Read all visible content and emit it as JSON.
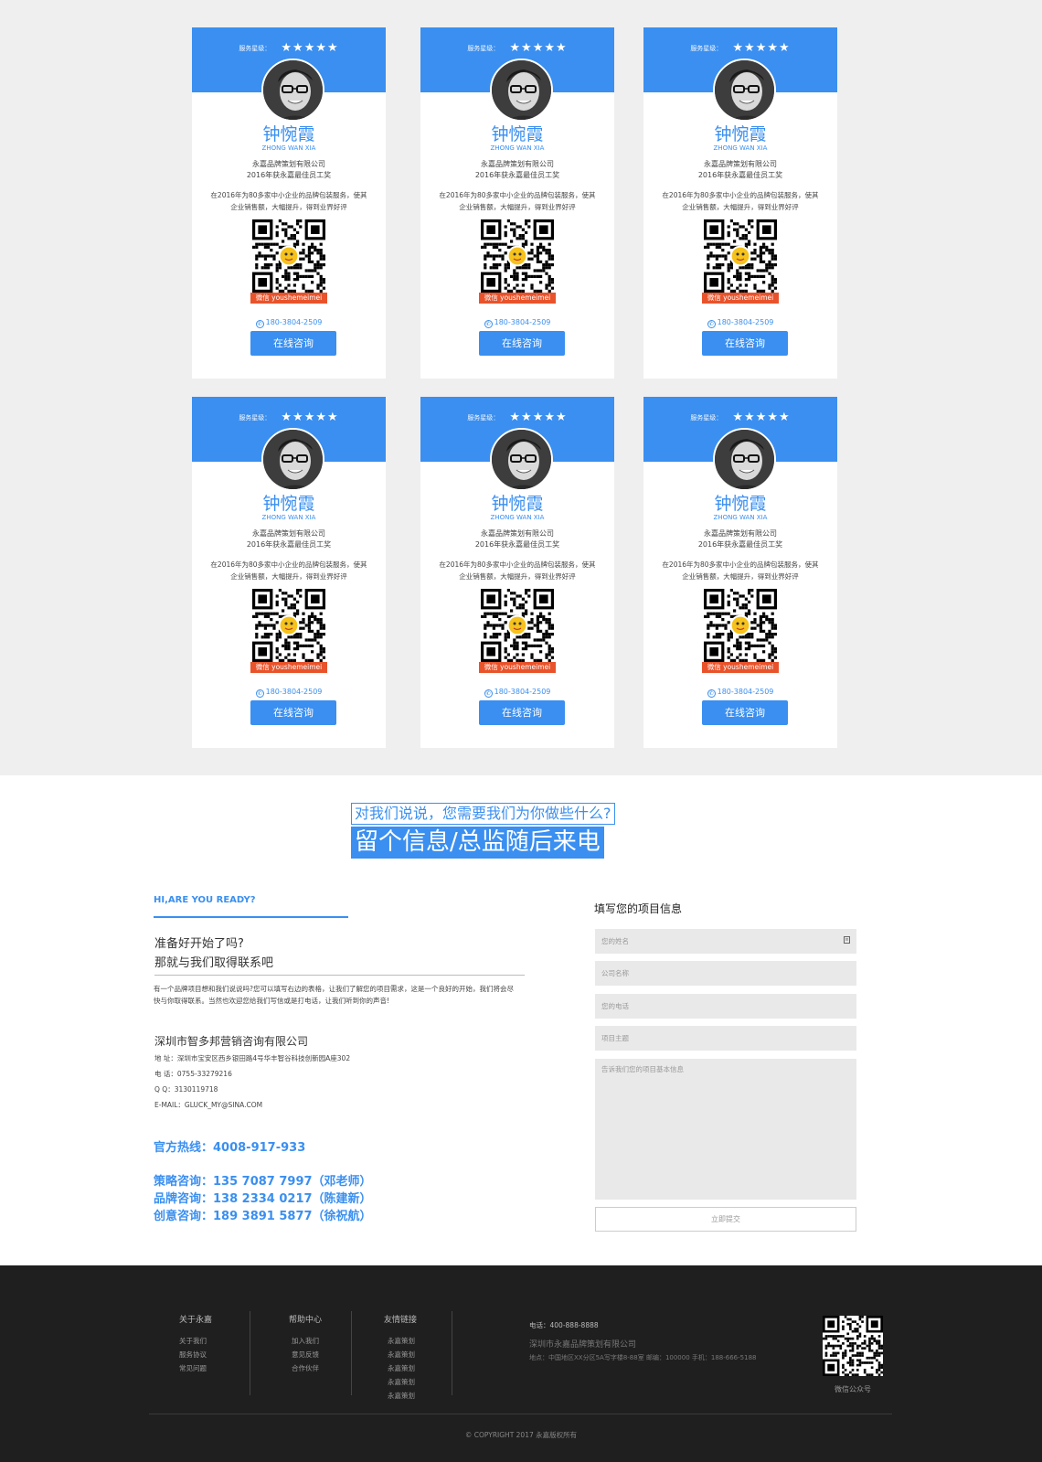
{
  "cards": [
    {
      "stars_label": "服务星级：",
      "stars": "★★★★★",
      "name": "钟惋霞",
      "pinyin": "ZHONG WAN XIA",
      "company": "永嘉品牌策划有限公司",
      "award": "2016年获永嘉最佳员工奖",
      "desc": "在2016年为80多家中小企业的品牌包装服务，使其企业销售额，大幅提升，得到业界好评",
      "wechat": "微信 youshemeimei",
      "phone": "180-3804-2509",
      "button": "在线咨询"
    },
    {
      "stars_label": "服务星级：",
      "stars": "★★★★★",
      "name": "钟惋霞",
      "pinyin": "ZHONG WAN XIA",
      "company": "永嘉品牌策划有限公司",
      "award": "2016年获永嘉最佳员工奖",
      "desc": "在2016年为80多家中小企业的品牌包装服务，使其企业销售额，大幅提升，得到业界好评",
      "wechat": "微信 youshemeimei",
      "phone": "180-3804-2509",
      "button": "在线咨询"
    },
    {
      "stars_label": "服务星级：",
      "stars": "★★★★★",
      "name": "钟惋霞",
      "pinyin": "ZHONG WAN XIA",
      "company": "永嘉品牌策划有限公司",
      "award": "2016年获永嘉最佳员工奖",
      "desc": "在2016年为80多家中小企业的品牌包装服务，使其企业销售额，大幅提升，得到业界好评",
      "wechat": "微信 youshemeimei",
      "phone": "180-3804-2509",
      "button": "在线咨询"
    },
    {
      "stars_label": "服务星级：",
      "stars": "★★★★★",
      "name": "钟惋霞",
      "pinyin": "ZHONG WAN XIA",
      "company": "永嘉品牌策划有限公司",
      "award": "2016年获永嘉最佳员工奖",
      "desc": "在2016年为80多家中小企业的品牌包装服务，使其企业销售额，大幅提升，得到业界好评",
      "wechat": "微信 youshemeimei",
      "phone": "180-3804-2509",
      "button": "在线咨询"
    },
    {
      "stars_label": "服务星级：",
      "stars": "★★★★★",
      "name": "钟惋霞",
      "pinyin": "ZHONG WAN XIA",
      "company": "永嘉品牌策划有限公司",
      "award": "2016年获永嘉最佳员工奖",
      "desc": "在2016年为80多家中小企业的品牌包装服务，使其企业销售额，大幅提升，得到业界好评",
      "wechat": "微信 youshemeimei",
      "phone": "180-3804-2509",
      "button": "在线咨询"
    },
    {
      "stars_label": "服务星级：",
      "stars": "★★★★★",
      "name": "钟惋霞",
      "pinyin": "ZHONG WAN XIA",
      "company": "永嘉品牌策划有限公司",
      "award": "2016年获永嘉最佳员工奖",
      "desc": "在2016年为80多家中小企业的品牌包装服务，使其企业销售额，大幅提升，得到业界好评",
      "wechat": "微信 youshemeimei",
      "phone": "180-3804-2509",
      "button": "在线咨询"
    }
  ],
  "cta": {
    "question": "对我们说说，您需要我们为你做些什么?",
    "headline": "留个信息/总监随后来电"
  },
  "contact": {
    "hi": "HI,ARE YOU READY?",
    "ready_q": "准备好开始了吗?",
    "ready_q2": "那就与我们取得联系吧",
    "intro": "有一个品牌项目想和我们说说吗?您可以填写右边的表格，让我们了解您的项目需求，这是一个良好的开始，我们将会尽快与你取得联系。当然也欢迎您给我们写信或是打电话，让我们听到你的声音!",
    "company_name": "深圳市智多邦营销咨询有限公司",
    "address": "地  址：深圳市宝安区西乡银田路4号华丰智谷科技创新园A座302",
    "tel": "电  话：0755-33279216",
    "qq": "Q  Q：3130119718",
    "email": "E-MAIL：GLUCK_MY@SINA.COM",
    "hotline": "官方热线：4008-917-933",
    "consult1": "策略咨询：135 7087 7997（邓老师）",
    "consult2": "品牌咨询：138 2334 0217（陈建新）",
    "consult3": "创意咨询：189 3891 5877（徐祝航）"
  },
  "form": {
    "title": "填写您的项目信息",
    "name_placeholder": "您的姓名",
    "company_placeholder": "公司名称",
    "phone_placeholder": "您的电话",
    "subject_placeholder": "项目主题",
    "message_placeholder": "告诉我们您的项目基本信息",
    "submit": "立即提交"
  },
  "footer": {
    "col1_title": "关于永嘉",
    "col1_items": [
      "关于我们",
      "服务协议",
      "常见问题"
    ],
    "col2_title": "帮助中心",
    "col2_items": [
      "加入我们",
      "意见反馈",
      "合作伙伴"
    ],
    "col3_title": "友情链接",
    "col3_items": [
      "永嘉策划",
      "永嘉策划",
      "永嘉策划",
      "永嘉策划",
      "永嘉策划"
    ],
    "tel": "电话：400-888-8888",
    "company": "深圳市永嘉品牌策划有限公司",
    "address": "地点：中国地区XX分区5A写字楼8-88室      邮编：100000      手机：188-666-5188",
    "qr_label": "微信公众号",
    "copyright": "© COPYRIGHT 2017 永嘉版权所有"
  }
}
